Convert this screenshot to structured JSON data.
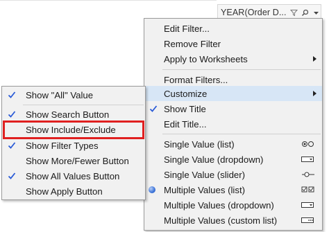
{
  "filter_card": {
    "title": "YEAR(Order D...",
    "icons": [
      "funnel-icon",
      "search-icon",
      "dropdown-arrow-icon"
    ]
  },
  "main_menu": {
    "items": [
      {
        "label": "Edit Filter..."
      },
      {
        "label": "Remove Filter"
      },
      {
        "label": "Apply to Worksheets",
        "submenu": true
      },
      {
        "label": "Format Filters..."
      },
      {
        "label": "Customize",
        "submenu": true,
        "highlighted": true
      },
      {
        "label": "Show Title",
        "checked": true
      },
      {
        "label": "Edit Title..."
      },
      {
        "label": "Single Value (list)",
        "icon": "radio-list-icon"
      },
      {
        "label": "Single Value (dropdown)",
        "icon": "dropdown-mode-icon"
      },
      {
        "label": "Single Value (slider)",
        "icon": "slider-mode-icon"
      },
      {
        "label": "Multiple Values (list)",
        "selected": true,
        "icon": "checkbox-list-icon"
      },
      {
        "label": "Multiple Values (dropdown)",
        "icon": "multi-dropdown-mode-icon"
      },
      {
        "label": "Multiple Values (custom list)",
        "icon": "custom-list-mode-icon"
      }
    ]
  },
  "customize_submenu": {
    "items": [
      {
        "label": "Show \"All\" Value",
        "checked": true
      },
      {
        "label": "Show Search Button",
        "checked": true
      },
      {
        "label": "Show Include/Exclude",
        "checked": false,
        "outlined": true
      },
      {
        "label": "Show Filter Types",
        "checked": true
      },
      {
        "label": "Show More/Fewer Button",
        "checked": false
      },
      {
        "label": "Show All Values Button",
        "checked": true
      },
      {
        "label": "Show Apply Button",
        "checked": false
      }
    ]
  },
  "colors": {
    "menu_bg": "#f1f1f1",
    "highlight": "#d7e6f6",
    "check": "#2a5bd7",
    "outline": "#e02020"
  }
}
